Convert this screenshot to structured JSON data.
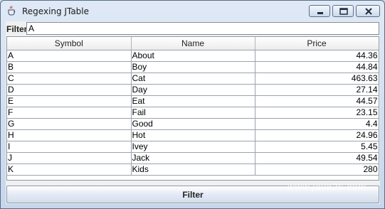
{
  "window": {
    "title": "Regexing JTable"
  },
  "filter": {
    "label": "Filter",
    "value": "A"
  },
  "table": {
    "columns": [
      "Symbol",
      "Name",
      "Price"
    ],
    "rows": [
      [
        "A",
        "About",
        "44.36"
      ],
      [
        "B",
        "Boy",
        "44.84"
      ],
      [
        "C",
        "Cat",
        "463.63"
      ],
      [
        "D",
        "Day",
        "27.14"
      ],
      [
        "E",
        "Eat",
        "44.57"
      ],
      [
        "F",
        "Fail",
        "23.15"
      ],
      [
        "G",
        "Good",
        "4.4"
      ],
      [
        "H",
        "Hot",
        "24.96"
      ],
      [
        "I",
        "Ivey",
        "5.45"
      ],
      [
        "J",
        "Jack",
        "49.54"
      ],
      [
        "K",
        "Kids",
        "280"
      ]
    ]
  },
  "button": {
    "label": "Filter"
  },
  "watermark": "www.java2s.com",
  "icons": {
    "app": "java-cup-icon",
    "minimize": "minimize-icon",
    "maximize": "maximize-icon",
    "close": "close-icon"
  }
}
